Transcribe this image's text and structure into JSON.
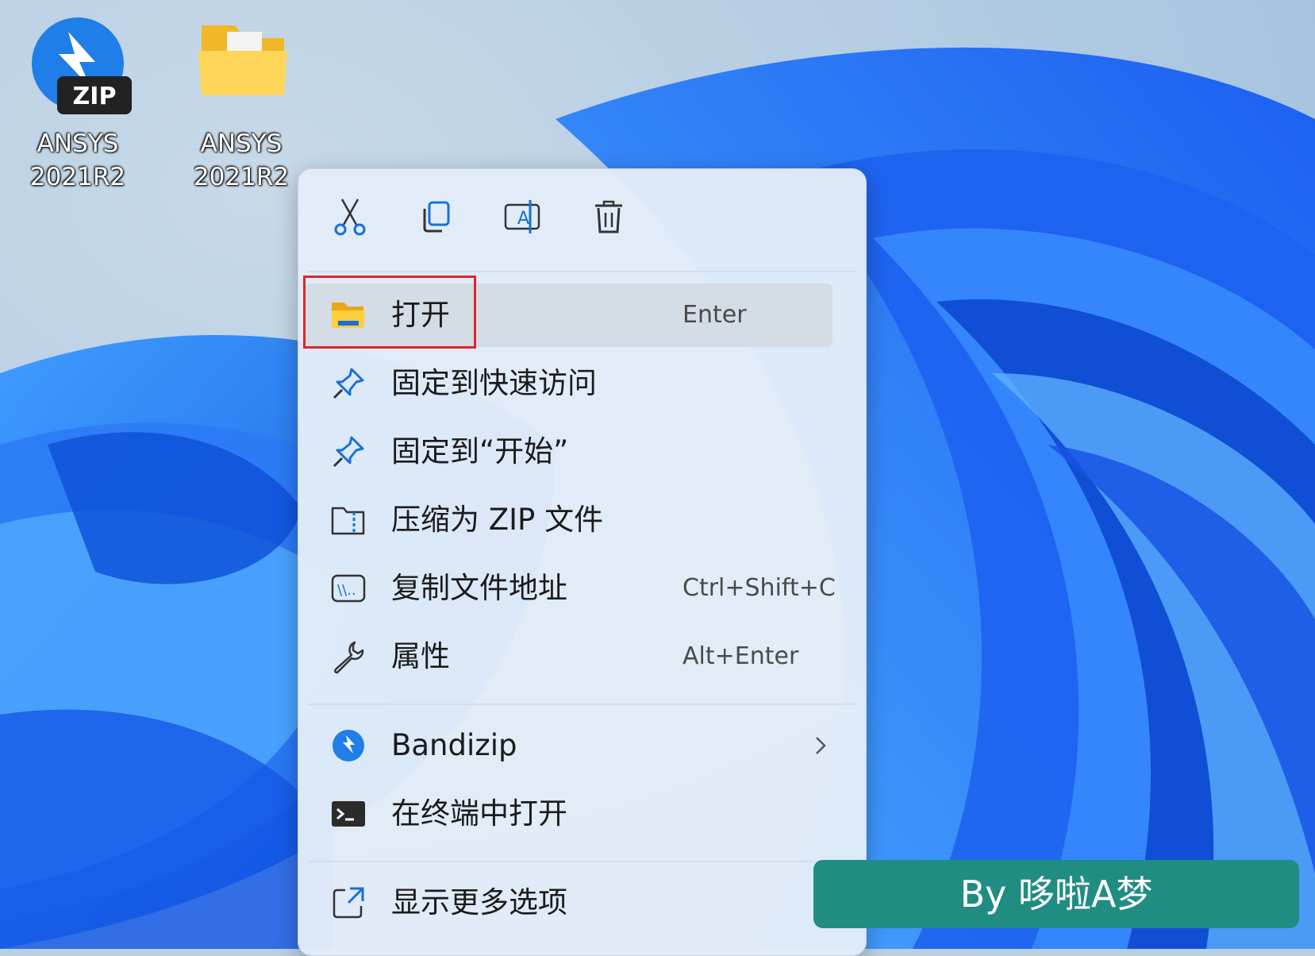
{
  "desktop": {
    "icons": [
      {
        "line1": "ANSYS",
        "line2": "2021R2",
        "icon": "bandizip-zip-icon"
      },
      {
        "line1": "ANSYS",
        "line2": "2021R2",
        "icon": "folder-icon"
      }
    ]
  },
  "context_menu": {
    "toolbar": [
      {
        "name": "cut",
        "icon": "scissors-icon"
      },
      {
        "name": "copy",
        "icon": "copy-icon"
      },
      {
        "name": "rename",
        "icon": "rename-icon"
      },
      {
        "name": "delete",
        "icon": "trash-icon"
      }
    ],
    "items": [
      {
        "label": "打开",
        "shortcut": "Enter",
        "icon": "folder-open-icon"
      },
      {
        "label": "固定到快速访问",
        "shortcut": "",
        "icon": "pin-icon"
      },
      {
        "label": "固定到“开始”",
        "shortcut": "",
        "icon": "pin-icon"
      },
      {
        "label": "压缩为 ZIP 文件",
        "shortcut": "",
        "icon": "zip-folder-icon"
      },
      {
        "label": "复制文件地址",
        "shortcut": "Ctrl+Shift+C",
        "icon": "path-icon"
      },
      {
        "label": "属性",
        "shortcut": "Alt+Enter",
        "icon": "wrench-icon"
      },
      {
        "label": "Bandizip",
        "shortcut": "",
        "icon": "bandizip-icon"
      },
      {
        "label": "在终端中打开",
        "shortcut": "",
        "icon": "terminal-icon"
      },
      {
        "label": "显示更多选项",
        "shortcut": "",
        "icon": "more-options-icon"
      }
    ]
  },
  "watermark": {
    "text": "By 哆啦A梦"
  },
  "colors": {
    "highlight_border": "#e0242a",
    "watermark_bg": "#1f8d82",
    "wallpaper_blue": "#1a63e8"
  }
}
